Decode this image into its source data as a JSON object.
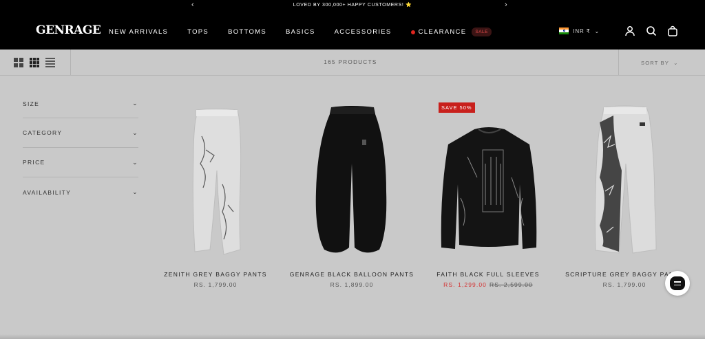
{
  "announcement": {
    "text": "LOVED BY 300,000+ HAPPY CUSTOMERS! ⭐",
    "prev_icon": "chevron-left-icon",
    "next_icon": "chevron-right-icon"
  },
  "header": {
    "logo": "GENRAGE",
    "nav": [
      {
        "label": "NEW ARRIVALS"
      },
      {
        "label": "TOPS"
      },
      {
        "label": "BOTTOMS"
      },
      {
        "label": "BASICS"
      },
      {
        "label": "ACCESSORIES"
      },
      {
        "label": "CLEARANCE",
        "badge": "SALE"
      }
    ],
    "currency": "INR ₹",
    "icons": [
      "account-icon",
      "search-icon",
      "cart-icon"
    ]
  },
  "toolbar": {
    "product_count": "165 PRODUCTS",
    "sort_label": "SORT BY"
  },
  "filters": [
    "SIZE",
    "CATEGORY",
    "PRICE",
    "AVAILABILITY"
  ],
  "products": [
    {
      "name": "ZENITH GREY BAGGY PANTS",
      "price": "RS. 1,799.00"
    },
    {
      "name": "GENRAGE BLACK BALLOON PANTS",
      "price": "RS. 1,899.00"
    },
    {
      "name": "FAITH BLACK FULL SLEEVES",
      "price": "RS. 1,299.00",
      "compare_price": "RS. 2,599.00",
      "badge": "SAVE 50%"
    },
    {
      "name": "SCRIPTURE GREY BAGGY PANTS",
      "price": "RS. 1,799.00"
    }
  ],
  "colors": {
    "header_bg": "#000000",
    "page_bg": "#c9c9c9",
    "sale_red": "#c8201c"
  }
}
